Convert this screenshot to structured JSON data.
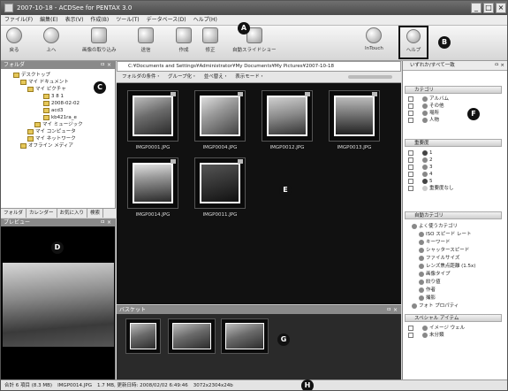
{
  "window": {
    "title": "2007-10-18 - ACDSee for PENTAX 3.0",
    "minimize": "_",
    "maximize": "□",
    "close": "×"
  },
  "menu": [
    "ファイル(F)",
    "編集(E)",
    "表示(V)",
    "作成(B)",
    "ツール(T)",
    "データベース(D)",
    "ヘルプ(H)"
  ],
  "toolbar": {
    "back": "戻る",
    "up": "上へ",
    "import": "画像の取り込み",
    "send": "送信",
    "create": "作成",
    "edit": "修正",
    "slideshow": "自動スライドショー",
    "intouch": "InTouch",
    "help": "ヘルプ"
  },
  "folders_panel": {
    "header": "フォルダ",
    "close": "ㅁ ×",
    "tree": [
      "デスクトップ",
      "マイ ドキュメント",
      "マイ ピクチャ",
      "3 8 1",
      "2008-02-02",
      "acd3",
      "kb421ra_e",
      "マイ ミュージック",
      "マイ コンピュータ",
      "マイ ネットワーク",
      "オフライン メディア"
    ],
    "tabs": [
      "フォルダ",
      "カレンダー",
      "お気に入り",
      "検索"
    ]
  },
  "preview_panel": {
    "header": "プレビュー",
    "close": "ㅁ ×"
  },
  "address": {
    "path": "C:¥Documents and Settings¥Administrator¥My Documents¥My Pictures¥2007-10-18"
  },
  "filterbar": [
    "フォルダの条件・",
    "グループ化・",
    "並べ替え・",
    "表示モード・"
  ],
  "thumbnails": [
    "IMGP0001.JPG",
    "IMGP0004.JPG",
    "IMGP0012.JPG",
    "IMGP0013.JPG",
    "IMGP0014.JPG",
    "IMGP0011.JPG"
  ],
  "basket": {
    "header": "バスケット",
    "close": "ㅁ ×"
  },
  "right_panel": {
    "header": "いずれか/すべて一致",
    "close": "ㅁ ×",
    "categories_header": "カテゴリ",
    "categories": [
      "アルバム",
      "その他",
      "場所",
      "人物"
    ],
    "importance_header": "重要度",
    "importance": [
      "1",
      "2",
      "3",
      "4",
      "5",
      "重要度なし"
    ],
    "auto_header": "自動カテゴリ",
    "auto_items": [
      "よく使うカテゴリ",
      "ISO スピード レート",
      "キーワード",
      "シャッタースピード",
      "ファイルサイズ",
      "レンズ焦点距離 (1.5x)",
      "画像タイプ",
      "絞り値",
      "作者",
      "撮影",
      "フォト プロパティ"
    ],
    "special_header": "スペシャル アイテム",
    "special": [
      "イメージ ウェル",
      "未分類"
    ]
  },
  "statusbar": {
    "total": "合計 6 項目 (8.3 MB)",
    "file": "IMGP0014.JPG",
    "info": "1.7 MB, 更新日時: 2008/02/02 6:49:46",
    "dims": "3072x2304x24b"
  },
  "callouts": [
    "A",
    "B",
    "C",
    "D",
    "E",
    "F",
    "G",
    "H"
  ]
}
